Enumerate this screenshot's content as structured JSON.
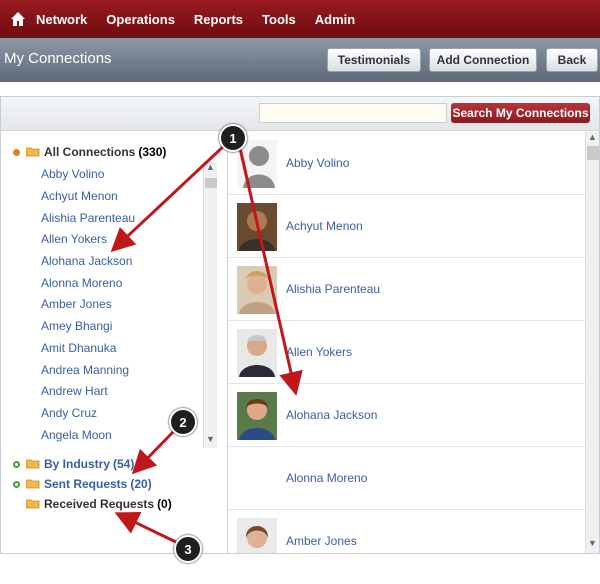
{
  "nav": {
    "items": [
      "Network",
      "Operations",
      "Reports",
      "Tools",
      "Admin"
    ]
  },
  "titlebar": {
    "title": "My Connections",
    "buttons": [
      "Testimonials",
      "Add Connection",
      "Back"
    ]
  },
  "search": {
    "placeholder": "",
    "button_label": "Search My Connections"
  },
  "tree": {
    "all": {
      "label": "All Connections",
      "count": "(330)"
    },
    "names": [
      "Abby Volino",
      "Achyut Menon",
      "Alishia Parenteau",
      "Allen Yokers",
      "Alohana Jackson",
      "Alonna Moreno",
      "Amber Jones",
      "Amey Bhangi",
      "Amit Dhanuka",
      "Andrea Manning",
      "Andrew Hart",
      "Andy Cruz",
      "Angela Moon"
    ],
    "by_industry": {
      "label": "By Industry",
      "count": "(54)"
    },
    "sent": {
      "label": "Sent Requests",
      "count": "(20)"
    },
    "received": {
      "label": "Received Requests",
      "count": "(0)"
    }
  },
  "connections": [
    "Abby Volino",
    "Achyut Menon",
    "Alishia Parenteau",
    "Allen Yokers",
    "Alohana Jackson",
    "Alonna Moreno",
    "Amber Jones"
  ],
  "callouts": [
    "1",
    "2",
    "3"
  ],
  "colors": {
    "brand": "#8a1b20",
    "link": "#3a5fa0",
    "arrow": "#c0171c"
  }
}
